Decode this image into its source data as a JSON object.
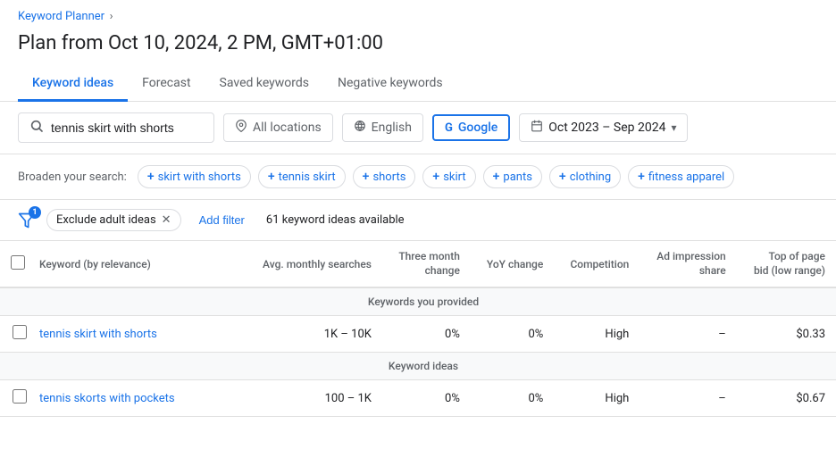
{
  "breadcrumb": {
    "label": "Keyword Planner",
    "chevron": "›"
  },
  "pageTitle": "Plan from Oct 10, 2024, 2 PM, GMT+01:00",
  "tabs": [
    {
      "label": "Keyword ideas",
      "active": true
    },
    {
      "label": "Forecast",
      "active": false
    },
    {
      "label": "Saved keywords",
      "active": false
    },
    {
      "label": "Negative keywords",
      "active": false
    }
  ],
  "toolbar": {
    "searchValue": "tennis skirt with shorts",
    "searchPlaceholder": "tennis skirt with shorts",
    "locationLabel": "All locations",
    "languageLabel": "English",
    "googleLabel": "Google",
    "dateRange": "Oct 2023 – Sep 2024",
    "locationIcon": "📍",
    "langIcon": "🌐",
    "googleIcon": "G",
    "calendarIcon": "📅"
  },
  "broadenSearch": {
    "label": "Broaden your search:",
    "chips": [
      "skirt with shorts",
      "tennis skirt",
      "shorts",
      "skirt",
      "pants",
      "clothing",
      "fitness apparel"
    ]
  },
  "filters": {
    "excludeLabel": "Exclude adult ideas",
    "addFilterLabel": "Add filter",
    "countText": "61 keyword ideas available",
    "badgeCount": "1"
  },
  "table": {
    "headers": [
      {
        "label": "",
        "key": "checkbox"
      },
      {
        "label": "Keyword (by relevance)",
        "key": "keyword"
      },
      {
        "label": "Avg. monthly searches",
        "key": "avg"
      },
      {
        "label": "Three month change",
        "key": "three_month"
      },
      {
        "label": "YoY change",
        "key": "yoy"
      },
      {
        "label": "Competition",
        "key": "competition"
      },
      {
        "label": "Ad impression share",
        "key": "ad_impression"
      },
      {
        "label": "Top of page bid (low range)",
        "key": "top_bid"
      }
    ],
    "sections": [
      {
        "sectionLabel": "Keywords you provided",
        "rows": [
          {
            "keyword": "tennis skirt with shorts",
            "avg": "1K – 10K",
            "three_month": "0%",
            "yoy": "0%",
            "competition": "High",
            "ad_impression": "–",
            "top_bid": "$0.33"
          }
        ]
      },
      {
        "sectionLabel": "Keyword ideas",
        "rows": [
          {
            "keyword": "tennis skorts with pockets",
            "avg": "100 – 1K",
            "three_month": "0%",
            "yoy": "0%",
            "competition": "High",
            "ad_impression": "–",
            "top_bid": "$0.67"
          }
        ]
      }
    ]
  }
}
